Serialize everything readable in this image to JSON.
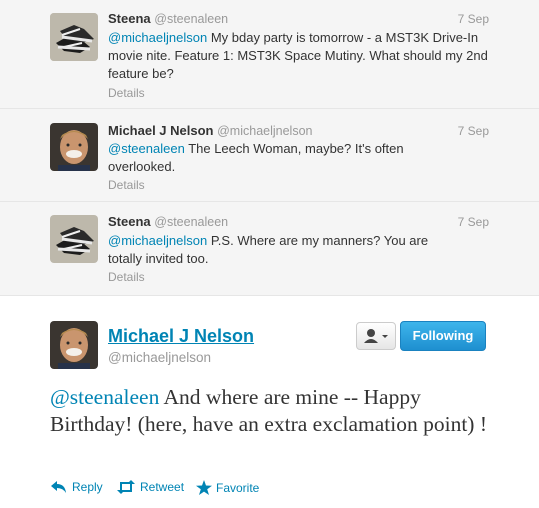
{
  "tweets": [
    {
      "name": "Steena",
      "screen": "@steenaleen",
      "time": "7 Sep",
      "mention": "@michaeljnelson",
      "text": " My bday party is tomorrow - a MST3K Drive-In movie nite. Feature 1: MST3K Space Mutiny. What should my 2nd feature be?",
      "details": "Details"
    },
    {
      "name": "Michael J Nelson",
      "screen": "@michaeljnelson",
      "time": "7 Sep",
      "mention": "@steenaleen",
      "text": " The Leech Woman, maybe? It's often overlooked.",
      "details": "Details"
    },
    {
      "name": "Steena",
      "screen": "@steenaleen",
      "time": "7 Sep",
      "mention": "@michaeljnelson",
      "text": " P.S. Where are my manners? You are totally invited too.",
      "details": "Details"
    }
  ],
  "main": {
    "name": "Michael J Nelson",
    "screen": "@michaeljnelson",
    "follow_label": "Following",
    "mention": "@steenaleen",
    "text": " And where are mine -- Happy Birthday! (here, have an extra exclamation point) !",
    "reply_label": "Reply",
    "retweet_label": "Retweet",
    "favorite_label": "Favorite"
  },
  "colors": {
    "link": "#0084b4",
    "follow": "#2ba1e0"
  },
  "icons": [
    "user-icon",
    "reply-icon",
    "retweet-icon",
    "star-icon"
  ]
}
